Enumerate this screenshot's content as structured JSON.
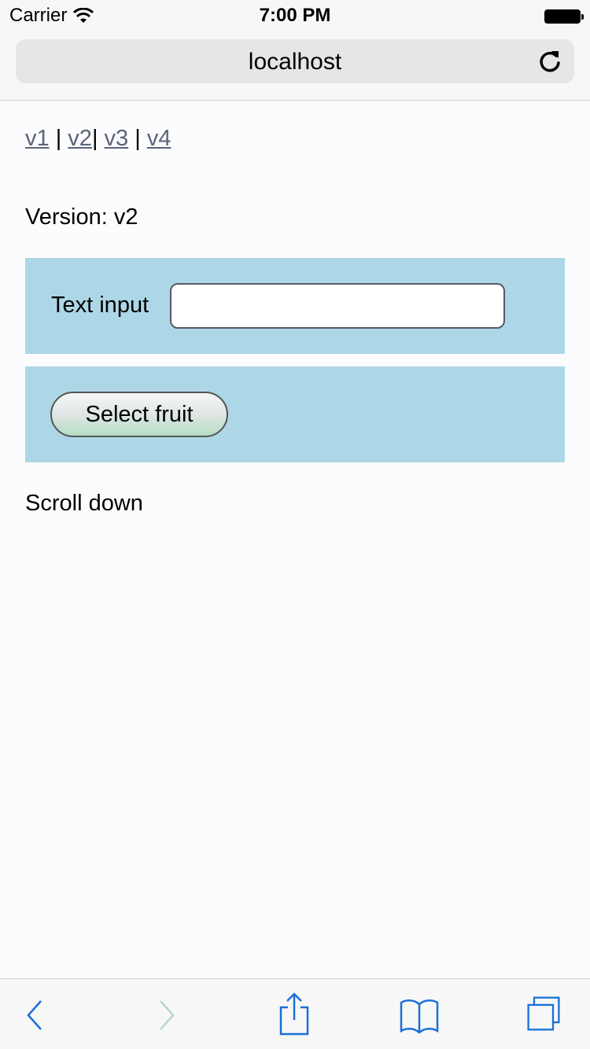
{
  "status_bar": {
    "carrier": "Carrier",
    "time": "7:00 PM"
  },
  "browser": {
    "url": "localhost"
  },
  "page": {
    "nav_links": [
      "v1",
      "v2",
      "v3",
      "v4"
    ],
    "nav_separators": [
      " | ",
      "| ",
      " | "
    ],
    "version_label": "Version: v2",
    "text_input_label": "Text input",
    "text_input_value": "",
    "select_button_label": "Select fruit",
    "scroll_text": "Scroll down",
    "panel_color": "#add7e6"
  },
  "toolbar": {
    "icons": [
      "back-icon",
      "forward-icon",
      "share-icon",
      "bookmarks-icon",
      "tabs-icon"
    ],
    "accent_color": "#1a6fd8"
  }
}
